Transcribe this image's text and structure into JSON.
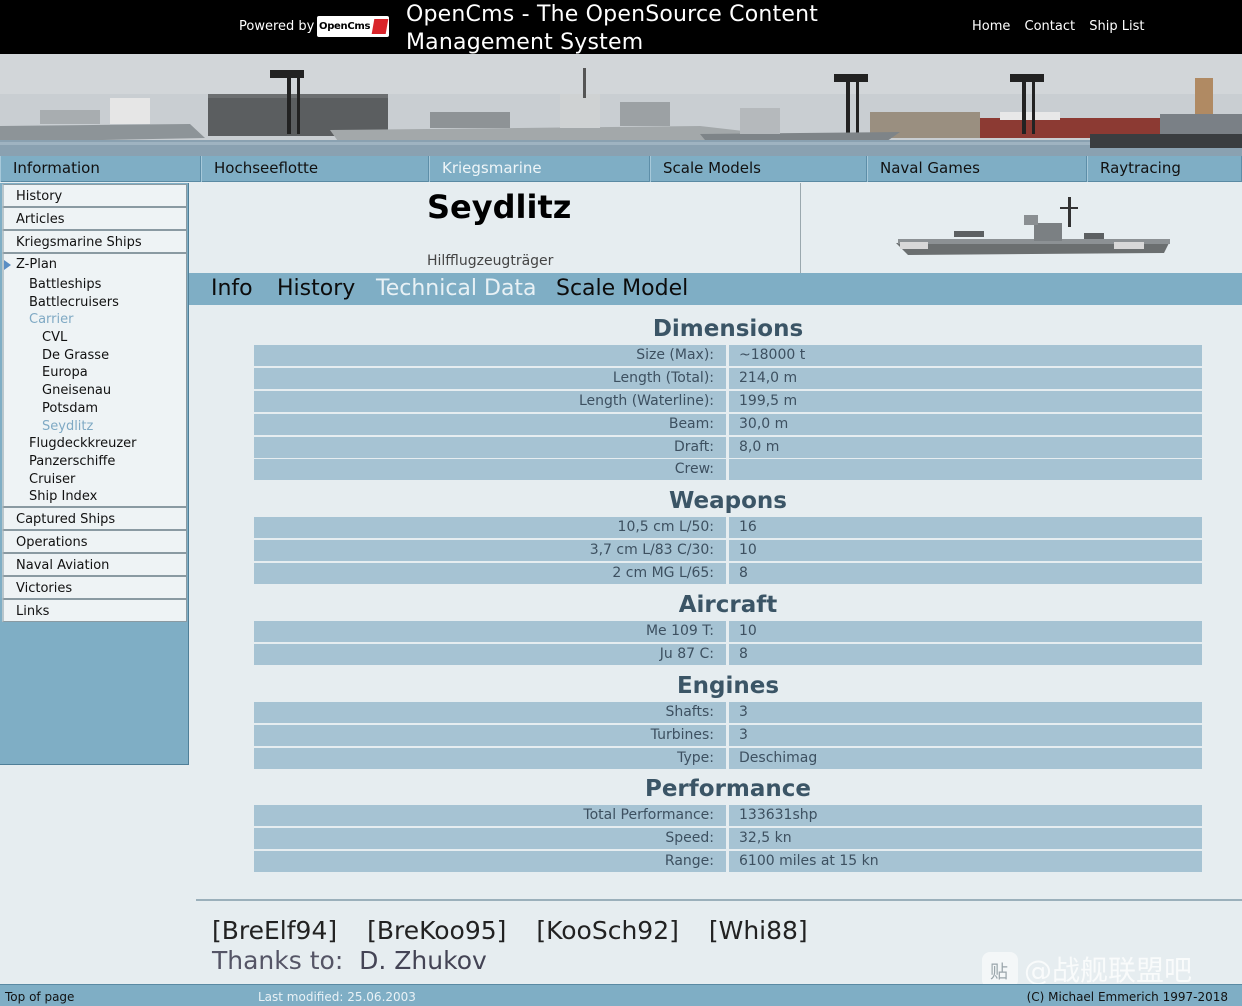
{
  "header": {
    "powered_by": "Powered by",
    "logo_text": "OpenCms",
    "site_title": "OpenCms - The OpenSource Content Management System",
    "links": [
      "Home",
      "Contact",
      "Ship List"
    ]
  },
  "main_nav": [
    "Information",
    "Hochseeflotte",
    "Kriegsmarine",
    "Scale Models",
    "Naval Games",
    "Raytracing"
  ],
  "sidebar": {
    "top_items": [
      "History",
      "Articles",
      "Kriegsmarine Ships"
    ],
    "open_section": {
      "label": "Z-Plan",
      "children": [
        {
          "label": "Battleships",
          "level": 1,
          "highlight": false
        },
        {
          "label": "Battlecruisers",
          "level": 1,
          "highlight": false
        },
        {
          "label": "Carrier",
          "level": 1,
          "highlight": true
        },
        {
          "label": "CVL",
          "level": 2,
          "highlight": false
        },
        {
          "label": "De Grasse",
          "level": 2,
          "highlight": false
        },
        {
          "label": "Europa",
          "level": 2,
          "highlight": false
        },
        {
          "label": "Gneisenau",
          "level": 2,
          "highlight": false
        },
        {
          "label": "Potsdam",
          "level": 2,
          "highlight": false
        },
        {
          "label": "Seydlitz",
          "level": 2,
          "highlight": true
        },
        {
          "label": "Flugdeckkreuzer",
          "level": 1,
          "highlight": false
        },
        {
          "label": "Panzerschiffe",
          "level": 1,
          "highlight": false
        },
        {
          "label": "Cruiser",
          "level": 1,
          "highlight": false
        },
        {
          "label": "Ship Index",
          "level": 1,
          "highlight": false
        }
      ]
    },
    "bottom_items": [
      "Captured Ships",
      "Operations",
      "Naval Aviation",
      "Victories",
      "Links"
    ]
  },
  "ship": {
    "name": "Seydlitz",
    "type": "Hilfflugzeugträger"
  },
  "sub_tabs": [
    "Info",
    "History",
    "Technical Data",
    "Scale Model"
  ],
  "sections": [
    {
      "title": "Dimensions",
      "rows": [
        [
          "Size (Max):",
          "~18000 t"
        ],
        [
          "Length (Total):",
          "214,0 m"
        ],
        [
          "Length (Waterline):",
          "199,5 m"
        ],
        [
          "Beam:",
          "30,0 m"
        ],
        [
          "Draft:",
          "8,0 m"
        ],
        [
          "Crew:",
          ""
        ]
      ]
    },
    {
      "title": "Weapons",
      "rows": [
        [
          "10,5 cm L/50:",
          "16"
        ],
        [
          "3,7 cm L/83 C/30:",
          "10"
        ],
        [
          "2 cm MG L/65:",
          "8"
        ]
      ]
    },
    {
      "title": "Aircraft",
      "rows": [
        [
          "Me 109 T:",
          "10"
        ],
        [
          "Ju 87 C:",
          "8"
        ]
      ]
    },
    {
      "title": "Engines",
      "rows": [
        [
          "Shafts:",
          "3"
        ],
        [
          "Turbines:",
          "3"
        ],
        [
          "Type:",
          "Deschimag"
        ]
      ]
    },
    {
      "title": "Performance",
      "rows": [
        [
          "Total Performance:",
          "133631shp"
        ],
        [
          "Speed:",
          "32,5 kn"
        ],
        [
          "Range:",
          "6100 miles at 15 kn"
        ]
      ]
    }
  ],
  "references": [
    "[BreElf94]",
    "[BreKoo95]",
    "[KooSch92]",
    "[Whi88]"
  ],
  "thanks": {
    "label": "Thanks to:",
    "name": "D. Zhukov"
  },
  "footer": {
    "top_of_page": "Top of page",
    "last_modified": "Last modified: 25.06.2003",
    "copyright": "(C) Michael Emmerich 1997-2018"
  },
  "watermark": "@战舰联盟吧",
  "colors": {
    "nav": "#7faec5",
    "row": "#a6c3d3",
    "background": "#e6edf0",
    "highlight": "#7fa9c4"
  }
}
